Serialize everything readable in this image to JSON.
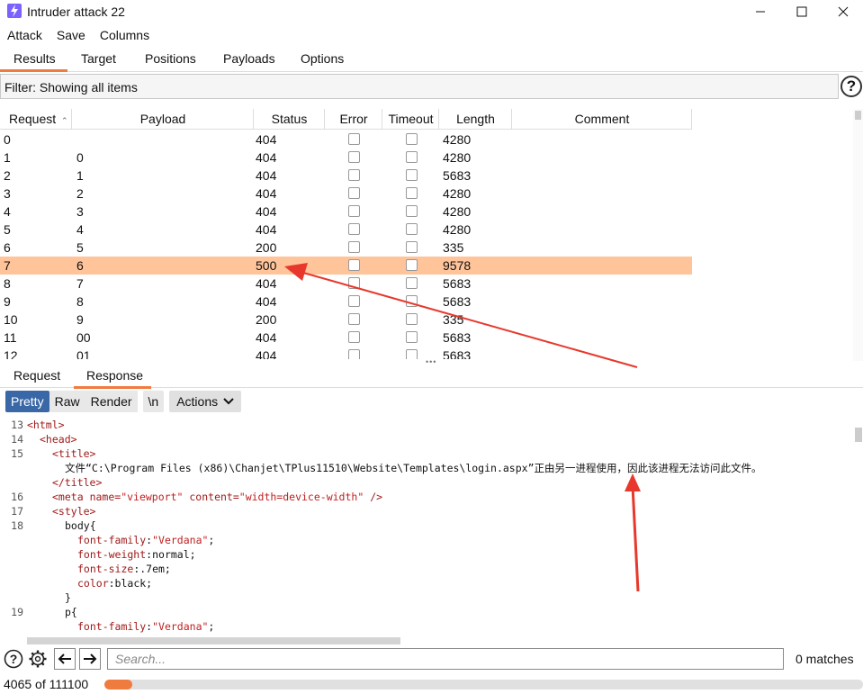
{
  "window": {
    "title": "Intruder attack 22"
  },
  "menu": [
    "Attack",
    "Save",
    "Columns"
  ],
  "tabs": [
    "Results",
    "Target",
    "Positions",
    "Payloads",
    "Options"
  ],
  "filter": {
    "text": "Filter: Showing all items"
  },
  "table": {
    "columns": [
      "Request",
      "Payload",
      "Status",
      "Error",
      "Timeout",
      "Length",
      "Comment"
    ],
    "rows": [
      {
        "request": "0",
        "payload": "",
        "status": "404",
        "length": "4280",
        "selected": false
      },
      {
        "request": "1",
        "payload": "0",
        "status": "404",
        "length": "4280",
        "selected": false
      },
      {
        "request": "2",
        "payload": "1",
        "status": "404",
        "length": "5683",
        "selected": false
      },
      {
        "request": "3",
        "payload": "2",
        "status": "404",
        "length": "4280",
        "selected": false
      },
      {
        "request": "4",
        "payload": "3",
        "status": "404",
        "length": "4280",
        "selected": false
      },
      {
        "request": "5",
        "payload": "4",
        "status": "404",
        "length": "4280",
        "selected": false
      },
      {
        "request": "6",
        "payload": "5",
        "status": "200",
        "length": "335",
        "selected": false
      },
      {
        "request": "7",
        "payload": "6",
        "status": "500",
        "length": "9578",
        "selected": true
      },
      {
        "request": "8",
        "payload": "7",
        "status": "404",
        "length": "5683",
        "selected": false
      },
      {
        "request": "9",
        "payload": "8",
        "status": "404",
        "length": "5683",
        "selected": false
      },
      {
        "request": "10",
        "payload": "9",
        "status": "200",
        "length": "335",
        "selected": false
      },
      {
        "request": "11",
        "payload": "00",
        "status": "404",
        "length": "5683",
        "selected": false
      },
      {
        "request": "12",
        "payload": "01",
        "status": "404",
        "length": "5683",
        "selected": false
      }
    ]
  },
  "message_tabs": [
    "Request",
    "Response"
  ],
  "view_buttons": [
    "Pretty",
    "Raw",
    "Render",
    "\\n"
  ],
  "actions_label": "Actions",
  "code_lines": [
    {
      "num": "13",
      "text": "<html>"
    },
    {
      "num": "14",
      "text": "<head>"
    },
    {
      "num": "15",
      "text": "<title>"
    },
    {
      "num": "",
      "text": "文件“C:\\Program Files (x86)\\Chanjet\\TPlus11510\\Website\\Templates\\login.aspx”正由另一进程使用，因此该进程无法访问此文件。"
    },
    {
      "num": "",
      "text": "</title>"
    },
    {
      "num": "16",
      "text": "<meta name=\"viewport\" content=\"width=device-width\" />"
    },
    {
      "num": "17",
      "text": "<style>"
    },
    {
      "num": "18",
      "text": "body{"
    },
    {
      "num": "",
      "text": "font-family:\"Verdana\";"
    },
    {
      "num": "",
      "text": "font-weight:normal;"
    },
    {
      "num": "",
      "text": "font-size:.7em;"
    },
    {
      "num": "",
      "text": "color:black;"
    },
    {
      "num": "",
      "text": "}"
    },
    {
      "num": "19",
      "text": "p{"
    },
    {
      "num": "",
      "text": "font-family:\"Verdana\";"
    }
  ],
  "search": {
    "placeholder": "Search..."
  },
  "matches": "0 matches",
  "progress": {
    "label": "4065 of 111100",
    "fraction": 0.0366
  },
  "colors": {
    "accent": "#f07b3f",
    "selected_row": "#ffc49a",
    "pretty_active": "#3a68a6",
    "annotation_arrow": "#e8382c"
  }
}
